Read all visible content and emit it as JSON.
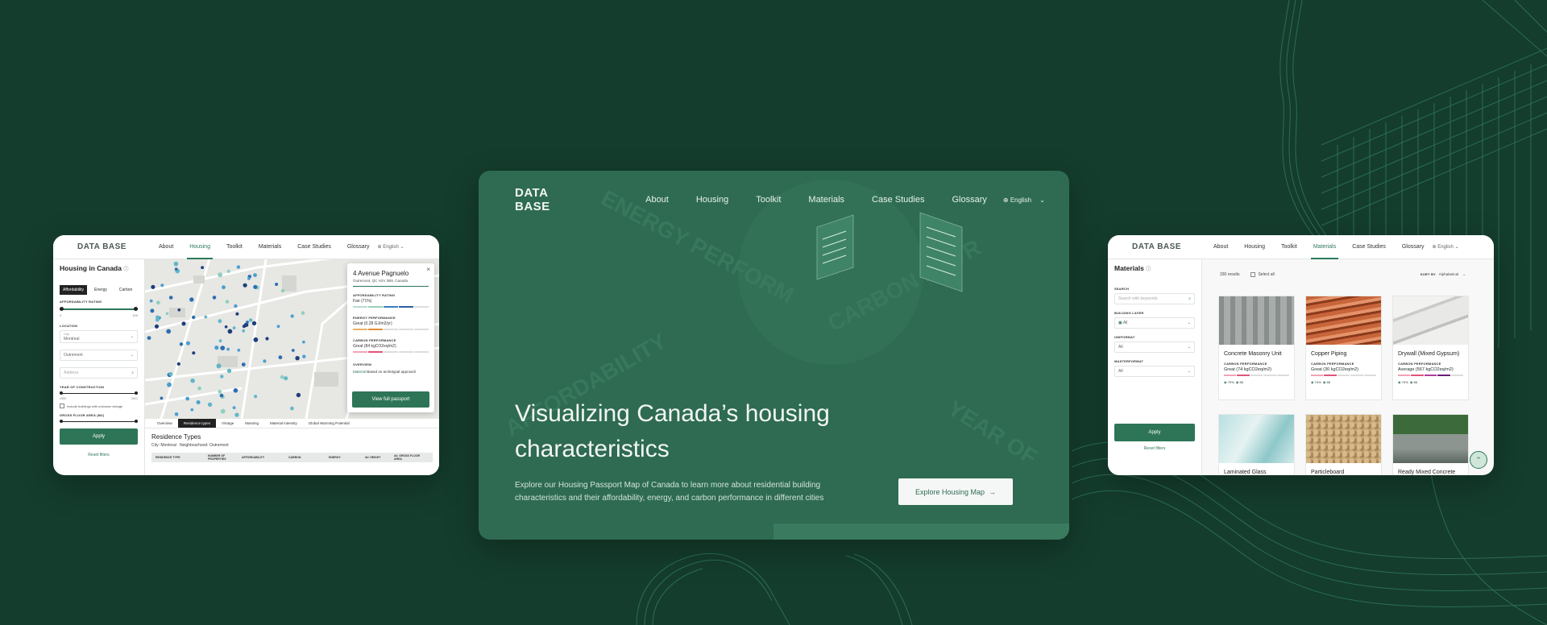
{
  "nav": {
    "logo": "DATA BASE",
    "items": [
      "About",
      "Housing",
      "Toolkit",
      "Materials",
      "Case Studies",
      "Glossary"
    ],
    "language": "English"
  },
  "hero": {
    "title": "Visualizing Canada’s housing characteristics",
    "subtitle": "Explore our Housing Passport Map of Canada to learn more about residential building characteristics and their affordability, energy, and carbon performance in different cities",
    "cta": "Explore Housing Map",
    "bg_words": [
      "ENERGY PERFORM",
      "CARBON METR",
      "AFFORDABILITY",
      "YEAR OF"
    ]
  },
  "housing": {
    "heading": "Housing in Canada",
    "tabs": [
      "Affordability",
      "Energy",
      "Carbon"
    ],
    "affordability_label": "AFFORDABILITY RATING",
    "range_min": "0",
    "range_max": "100",
    "location_label": "LOCATION",
    "city_label": "City",
    "city_value": "Montreal",
    "neighbourhood_value": "Outremont",
    "address_placeholder": "Address",
    "year_label": "YEAR OF CONSTRUCTION",
    "year_min": "1900",
    "year_max": "2021",
    "include_label": "Include buildings with unknown vintage",
    "gfa_label": "GROSS FLOOR AREA (M2)",
    "apply": "Apply",
    "reset": "Reset filters",
    "popup": {
      "title": "4 Avenue Pagnuelo",
      "address": "Outremont, QC H2V 3B9, Canada",
      "aff_label": "AFFORDABILITY RATING",
      "aff_value": "Fair (71%)",
      "energy_label": "ENERGY PERFORMANCE",
      "energy_value": "Great (0.28 GJ/m2/yr)",
      "carbon_label": "CARBON PERFORMANCE",
      "carbon_value": "Great (84 kgCO2eq/m2)",
      "overview_label": "OVERVIEW",
      "overview_key": "Material",
      "overview_value": "Based on archetypal approach",
      "button": "View full passport"
    },
    "bottom_tabs": [
      "Overview",
      "Residence types",
      "Vintage",
      "Massing",
      "Material intensity",
      "Global Warming Potential"
    ],
    "section_title": "Residence Types",
    "city_line": "City: Montreal",
    "neigh_line": "Neighbourhood: Outremont",
    "table_headers": [
      "RESIDENCE TYPE",
      "NUMBER OF PROPERTIES",
      "AFFORDABILITY",
      "CARBON",
      "ENERGY",
      "AV. HEIGHT",
      "AV. GROSS FLOOR AREA"
    ]
  },
  "materials": {
    "heading": "Materials",
    "results": "330 results",
    "select_all": "Select all",
    "sort_label": "SORT BY",
    "sort_value": "Alphabetical",
    "search_label": "SEARCH",
    "search_placeholder": "Search with keywords",
    "layer_label": "BUILDING LAYER",
    "layer_value": "All",
    "uniformat_label": "UNIFORMAT",
    "uniformat_value": "All",
    "masterformat_label": "MASTERFORMAT",
    "masterformat_value": "All",
    "apply": "Apply",
    "reset": "Reset filters",
    "perf_label": "CARBON PERFORMANCE",
    "cards": [
      {
        "name": "Concrete Masonry Unit",
        "perf": "Great (74 kgCO2eq/m2)",
        "pct": "70%",
        "count": "86"
      },
      {
        "name": "Copper Piping",
        "perf": "Great (30 kgCO2eq/m2)",
        "pct": "74%",
        "count": "86"
      },
      {
        "name": "Drywall (Mixed Gypsum)",
        "perf": "Average (567 kgCO2eq/m2)",
        "pct": "70%",
        "count": "86"
      },
      {
        "name": "Laminated Glass",
        "perf": "",
        "pct": "",
        "count": ""
      },
      {
        "name": "Particleboard",
        "perf": "",
        "pct": "",
        "count": ""
      },
      {
        "name": "Ready Mixed Concrete",
        "perf": "",
        "pct": "",
        "count": ""
      }
    ]
  }
}
